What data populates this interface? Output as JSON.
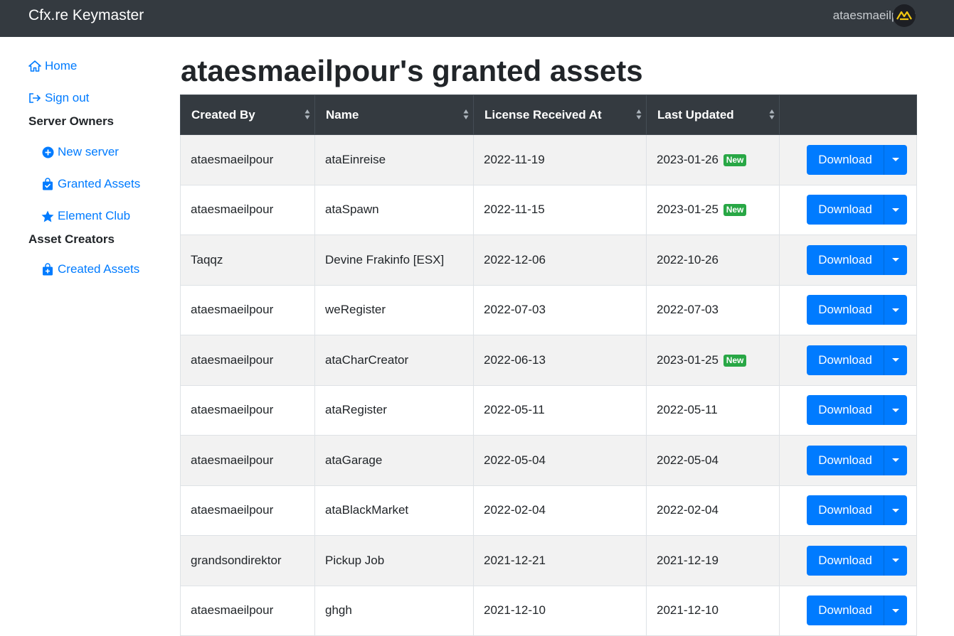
{
  "navbar": {
    "brand": "Cfx.re Keymaster",
    "username": "ataesmaeilpour"
  },
  "sidebar": {
    "home_label": "Home",
    "signout_label": "Sign out",
    "server_owners_heading": "Server Owners",
    "new_server_label": "New server",
    "granted_assets_label": "Granted Assets",
    "element_club_label": "Element Club",
    "asset_creators_heading": "Asset Creators",
    "created_assets_label": "Created Assets"
  },
  "page": {
    "title": "ataesmaeilpour's granted assets"
  },
  "table": {
    "headers": [
      "Created By",
      "Name",
      "License Received At",
      "Last Updated",
      ""
    ],
    "download_label": "Download",
    "new_badge_label": "New",
    "rows": [
      {
        "created_by": "ataesmaeilpour",
        "name": "ataEinreise",
        "license_received": "2022-11-19",
        "last_updated": "2023-01-26",
        "is_new": true
      },
      {
        "created_by": "ataesmaeilpour",
        "name": "ataSpawn",
        "license_received": "2022-11-15",
        "last_updated": "2023-01-25",
        "is_new": true
      },
      {
        "created_by": "Taqqz",
        "name": "Devine Frakinfo [ESX]",
        "license_received": "2022-12-06",
        "last_updated": "2022-10-26",
        "is_new": false
      },
      {
        "created_by": "ataesmaeilpour",
        "name": "weRegister",
        "license_received": "2022-07-03",
        "last_updated": "2022-07-03",
        "is_new": false
      },
      {
        "created_by": "ataesmaeilpour",
        "name": "ataCharCreator",
        "license_received": "2022-06-13",
        "last_updated": "2023-01-25",
        "is_new": true
      },
      {
        "created_by": "ataesmaeilpour",
        "name": "ataRegister",
        "license_received": "2022-05-11",
        "last_updated": "2022-05-11",
        "is_new": false
      },
      {
        "created_by": "ataesmaeilpour",
        "name": "ataGarage",
        "license_received": "2022-05-04",
        "last_updated": "2022-05-04",
        "is_new": false
      },
      {
        "created_by": "ataesmaeilpour",
        "name": "ataBlackMarket",
        "license_received": "2022-02-04",
        "last_updated": "2022-02-04",
        "is_new": false
      },
      {
        "created_by": "grandsondirektor",
        "name": "Pickup Job",
        "license_received": "2021-12-21",
        "last_updated": "2021-12-19",
        "is_new": false
      },
      {
        "created_by": "ataesmaeilpour",
        "name": "ghgh",
        "license_received": "2021-12-10",
        "last_updated": "2021-12-10",
        "is_new": false
      }
    ]
  },
  "colors": {
    "navbar_bg": "#343a40",
    "link": "#007bff",
    "primary_button": "#007bff",
    "badge_new": "#28a745",
    "logo_accent": "#f2c811"
  },
  "icons": {
    "home": "home-icon",
    "signout": "sign-out-icon",
    "new_server": "plus-circle-icon",
    "granted_assets": "shopping-bag-check-icon",
    "element_club": "star-icon",
    "created_assets": "shopping-bag-plus-icon",
    "sort": "sort-icon",
    "caret": "caret-down-icon",
    "avatar": "cfx-logo-icon"
  }
}
